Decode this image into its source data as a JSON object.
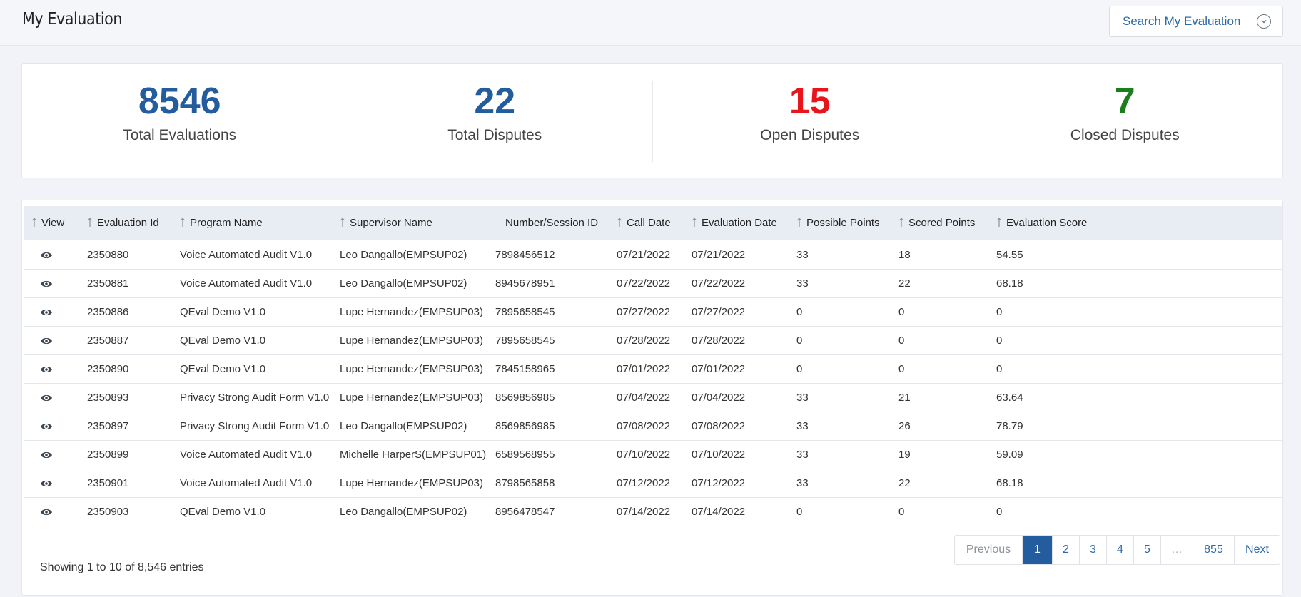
{
  "header": {
    "title": "My Evaluation",
    "search_label": "Search My Evaluation"
  },
  "stats": [
    {
      "value": "8546",
      "label": "Total Evaluations",
      "color": "#245d9e"
    },
    {
      "value": "22",
      "label": "Total Disputes",
      "color": "#245d9e"
    },
    {
      "value": "15",
      "label": "Open Disputes",
      "color": "#e8151b"
    },
    {
      "value": "7",
      "label": "Closed Disputes",
      "color": "#1a7f1a"
    }
  ],
  "table": {
    "columns": [
      "View",
      "Evaluation Id",
      "Program Name",
      "Supervisor Name",
      "Number/Session ID",
      "Call Date",
      "Evaluation Date",
      "Possible Points",
      "Scored Points",
      "Evaluation Score"
    ],
    "rows": [
      [
        "2350880",
        "Voice Automated Audit V1.0",
        "Leo Dangallo(EMPSUP02)",
        "7898456512",
        "07/21/2022",
        "07/21/2022",
        "33",
        "18",
        "54.55"
      ],
      [
        "2350881",
        "Voice Automated Audit V1.0",
        "Leo Dangallo(EMPSUP02)",
        "8945678951",
        "07/22/2022",
        "07/22/2022",
        "33",
        "22",
        "68.18"
      ],
      [
        "2350886",
        "QEval Demo V1.0",
        "Lupe Hernandez(EMPSUP03)",
        "7895658545",
        "07/27/2022",
        "07/27/2022",
        "0",
        "0",
        "0"
      ],
      [
        "2350887",
        "QEval Demo V1.0",
        "Lupe Hernandez(EMPSUP03)",
        "7895658545",
        "07/28/2022",
        "07/28/2022",
        "0",
        "0",
        "0"
      ],
      [
        "2350890",
        "QEval Demo V1.0",
        "Lupe Hernandez(EMPSUP03)",
        "7845158965",
        "07/01/2022",
        "07/01/2022",
        "0",
        "0",
        "0"
      ],
      [
        "2350893",
        "Privacy Strong Audit Form V1.0",
        "Lupe Hernandez(EMPSUP03)",
        "8569856985",
        "07/04/2022",
        "07/04/2022",
        "33",
        "21",
        "63.64"
      ],
      [
        "2350897",
        "Privacy Strong Audit Form V1.0",
        "Leo Dangallo(EMPSUP02)",
        "8569856985",
        "07/08/2022",
        "07/08/2022",
        "33",
        "26",
        "78.79"
      ],
      [
        "2350899",
        "Voice Automated Audit V1.0",
        "Michelle HarperS(EMPSUP01)",
        "6589568955",
        "07/10/2022",
        "07/10/2022",
        "33",
        "19",
        "59.09"
      ],
      [
        "2350901",
        "Voice Automated Audit V1.0",
        "Lupe Hernandez(EMPSUP03)",
        "8798565858",
        "07/12/2022",
        "07/12/2022",
        "33",
        "22",
        "68.18"
      ],
      [
        "2350903",
        "QEval Demo V1.0",
        "Leo Dangallo(EMPSUP02)",
        "8956478547",
        "07/14/2022",
        "07/14/2022",
        "0",
        "0",
        "0"
      ]
    ],
    "view_icon": "eye-icon"
  },
  "footer": {
    "showing": "Showing 1 to 10 of 8,546 entries",
    "pagination": [
      "Previous",
      "1",
      "2",
      "3",
      "4",
      "5",
      "…",
      "855",
      "Next"
    ],
    "active_page": "1"
  }
}
